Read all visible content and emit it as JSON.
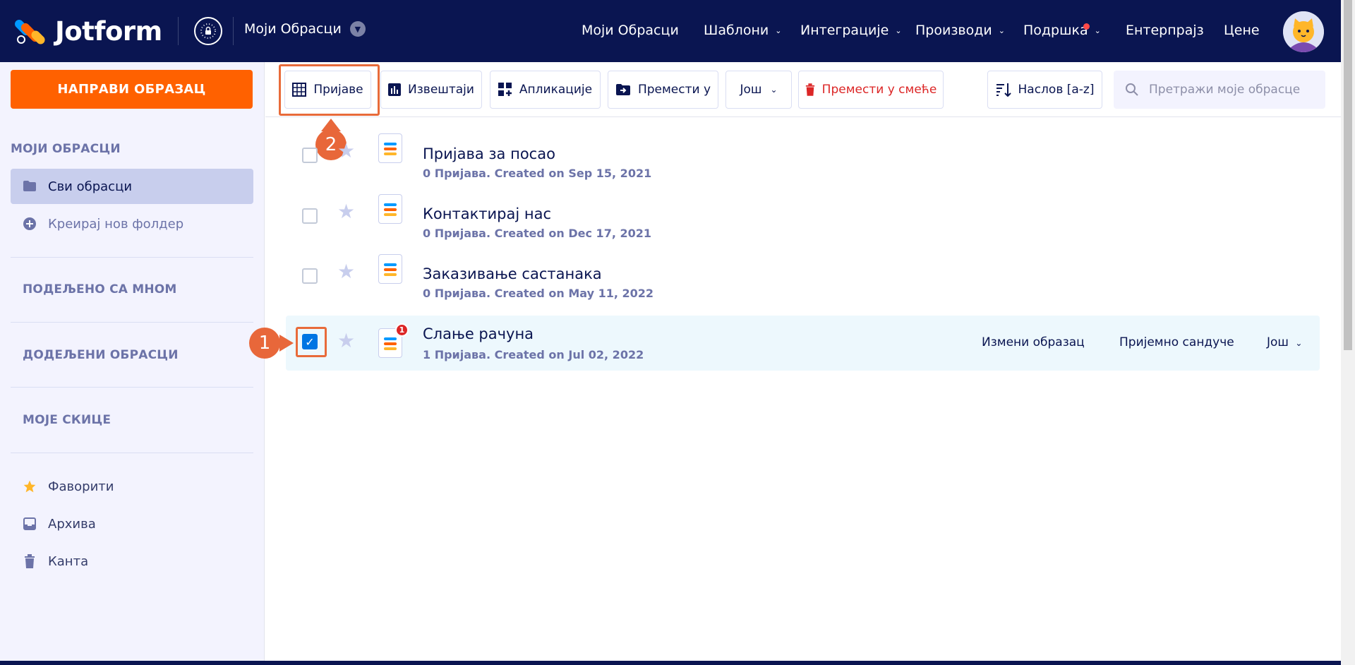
{
  "brand": {
    "name": "Jotform"
  },
  "header": {
    "workspace": "Моји Обрасци",
    "nav": [
      {
        "label": "Моји Обрасци",
        "caret": false
      },
      {
        "label": "Шаблони",
        "caret": true
      },
      {
        "label": "Интеграције",
        "caret": true
      },
      {
        "label": "Производи",
        "caret": true
      },
      {
        "label": "Подршка",
        "caret": true
      },
      {
        "label": "Ентерпрајз",
        "caret": false
      },
      {
        "label": "Цене",
        "caret": false
      }
    ]
  },
  "sidebar": {
    "create_label": "НАПРАВИ ОБРАЗАЦ",
    "my_forms_heading": "МОЈИ ОБРАСЦИ",
    "all_forms": "Сви обрасци",
    "new_folder": "Креирај нов фолдер",
    "shared": "ПОДЕЉЕНО СА МНОМ",
    "assigned": "ДОДЕЉЕНИ ОБРАСЦИ",
    "drafts": "МОЈЕ СКИЦЕ",
    "favorites": "Фаворити",
    "archive": "Архива",
    "trash": "Канта"
  },
  "toolbar": {
    "submissions": "Пријаве",
    "reports": "Извештаји",
    "apps": "Апликације",
    "move_to": "Премести у",
    "more": "Још",
    "move_to_trash": "Премести у смеће",
    "sort": "Наслов [a-z]",
    "search_placeholder": "Претражи моје обрасце"
  },
  "steps": {
    "one": "1",
    "two": "2"
  },
  "forms": [
    {
      "title": "Пријава за посао",
      "subtitle": "0 Пријава. Created on Sep 15, 2021",
      "checked": false
    },
    {
      "title": "Контактирај нас",
      "subtitle": "0 Пријава. Created on Dec 17, 2021",
      "checked": false
    },
    {
      "title": "Заказивање састанака",
      "subtitle": "0 Пријава. Created on May 11, 2022",
      "checked": false
    },
    {
      "title": "Слање рачуна",
      "subtitle": "1 Пријава. Created on Jul 02, 2022",
      "checked": true,
      "badge": "1"
    }
  ],
  "row_actions": {
    "edit": "Измени образац",
    "inbox": "Пријемно сандуче",
    "more": "Још"
  },
  "colors": {
    "navy": "#0a1551",
    "orange": "#ff6100",
    "annotation": "#e8673a",
    "check_blue": "#0075e3"
  }
}
